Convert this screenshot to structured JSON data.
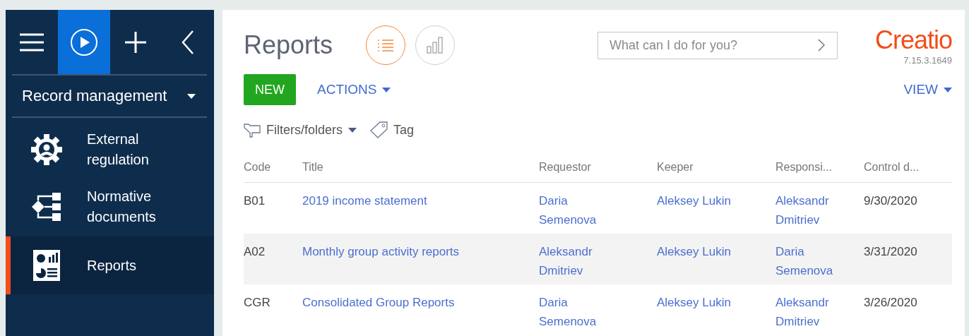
{
  "sidebar": {
    "top_buttons": [
      {
        "kind": "menu",
        "selected": false
      },
      {
        "kind": "play",
        "selected": true
      },
      {
        "kind": "add",
        "selected": false
      },
      {
        "kind": "collapse",
        "selected": false
      }
    ],
    "workplace": "Record management",
    "items": [
      {
        "label": "External regulation",
        "kind": "gear",
        "selected": false
      },
      {
        "label": "Normative documents",
        "kind": "flow",
        "selected": false
      },
      {
        "label": "Reports",
        "kind": "report",
        "selected": true
      }
    ]
  },
  "header": {
    "title": "Reports",
    "view_modes": [
      {
        "kind": "list",
        "selected": true
      },
      {
        "kind": "chart",
        "selected": false
      }
    ],
    "search": {
      "placeholder": "What can I do for you?"
    },
    "logo": "Creatio",
    "version": "7.15.3.1649"
  },
  "toolbar": {
    "new_button": "NEW",
    "actions": "ACTIONS",
    "view": "VIEW",
    "filters": "Filters/folders",
    "tag": "Tag"
  },
  "table": {
    "columns": [
      "Code",
      "Title",
      "Requestor",
      "Keeper",
      "Responsi...",
      "Control d..."
    ],
    "rows": [
      {
        "cells": [
          "B01",
          "2019 income statement",
          "Daria Semenova",
          "Aleksey Lukin",
          "Aleksandr Dmitriev",
          "9/30/2020"
        ],
        "shaded": false
      },
      {
        "cells": [
          "A02",
          "Monthly group activity reports",
          "Aleksandr Dmitriev",
          "Aleksey Lukin",
          "Daria Semenova",
          "3/31/2020"
        ],
        "shaded": true
      },
      {
        "cells": [
          "CGR",
          "Consolidated Group Reports",
          "Daria Semenova",
          "Aleksey Lukin",
          "Aleksandr Dmitriev",
          "3/26/2020"
        ],
        "shaded": false
      }
    ]
  }
}
